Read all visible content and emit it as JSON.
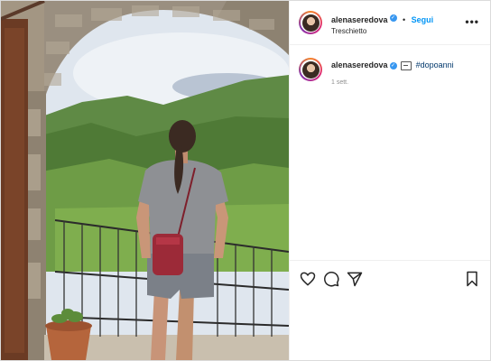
{
  "post": {
    "username": "alenaseredova",
    "separator": "•",
    "follow_label": "Segui",
    "location": "Treschietto",
    "more_label": "•••"
  },
  "caption": {
    "username": "alenaseredova",
    "hashtag": "#dopoanni",
    "time": "1 sett."
  },
  "colors": {
    "accent": "#0095f6",
    "verified": "#3897f0",
    "hashtag": "#00376b"
  },
  "icons": [
    "heart-icon",
    "comment-icon",
    "share-icon",
    "bookmark-icon",
    "verified-icon",
    "more-options-icon"
  ]
}
